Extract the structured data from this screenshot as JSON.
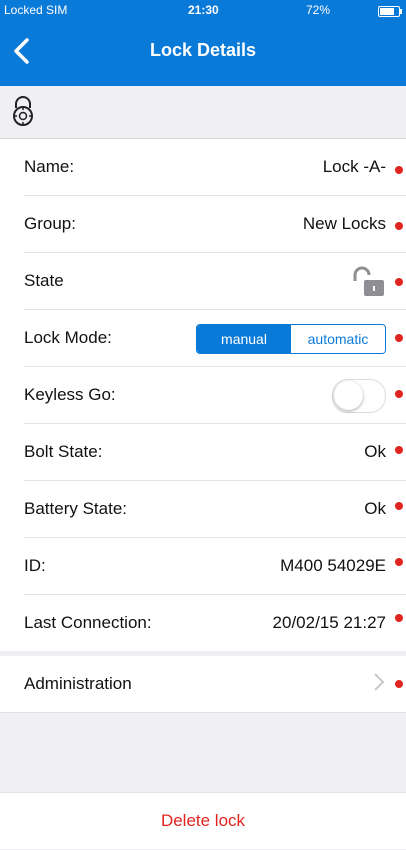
{
  "status_bar": {
    "carrier": "Locked SIM",
    "time": "21:30",
    "battery": "72%",
    "battery_level": 0.72
  },
  "nav": {
    "back_icon": "chevron-left-icon",
    "title": "Lock Details"
  },
  "header": {
    "icon": "combination-lock-icon"
  },
  "rows": {
    "name": {
      "label": "Name:",
      "value": "Lock -A-"
    },
    "group": {
      "label": "Group:",
      "value": "New Locks"
    },
    "state": {
      "label": "State",
      "icon": "open-padlock-icon"
    },
    "lock_mode": {
      "label": "Lock Mode:",
      "options": [
        "manual",
        "automatic"
      ],
      "selected": "manual"
    },
    "keyless_go": {
      "label": "Keyless Go:",
      "enabled": false
    },
    "bolt_state": {
      "label": "Bolt State:",
      "value": "Ok"
    },
    "battery_state": {
      "label": "Battery State:",
      "value": "Ok"
    },
    "id": {
      "label": "ID:",
      "value": "M400 54029E"
    },
    "last_connection": {
      "label": "Last Connection:",
      "value": "20/02/15 21:27"
    }
  },
  "administration": {
    "label": "Administration",
    "icon": "chevron-right-icon"
  },
  "delete": {
    "label": "Delete lock"
  },
  "colors": {
    "accent": "#0a7ad9",
    "danger": "#e0251f",
    "background": "#f0eff4"
  }
}
